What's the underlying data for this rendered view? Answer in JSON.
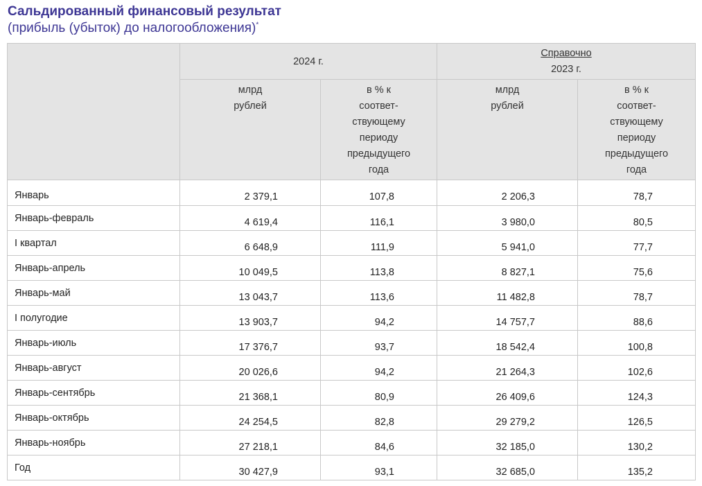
{
  "header": {
    "title": "Сальдированный финансовый результат",
    "subtitle": "(прибыль (убыток) до налогообложения)",
    "footnote_mark": "*"
  },
  "table": {
    "group_2024": "2024 г.",
    "group_ref_label": "Справочно",
    "group_ref_year": "2023 г.",
    "col_bln": "млрд\nрублей",
    "col_pct": "в % к\nсоответ-\nствующему\nпериоду\nпредыдущего\nгода",
    "rows": [
      {
        "label": "Январь",
        "v2024": "2 379,1",
        "p2024": "107,8",
        "v2023": "2 206,3",
        "p2023": "78,7"
      },
      {
        "label": "Январь-февраль",
        "v2024": "4 619,4",
        "p2024": "116,1",
        "v2023": "3 980,0",
        "p2023": "80,5"
      },
      {
        "label": "I квартал",
        "v2024": "6 648,9",
        "p2024": "111,9",
        "v2023": "5 941,0",
        "p2023": "77,7"
      },
      {
        "label": "Январь-апрель",
        "v2024": "10 049,5",
        "p2024": "113,8",
        "v2023": "8 827,1",
        "p2023": "75,6"
      },
      {
        "label": "Январь-май",
        "v2024": "13 043,7",
        "p2024": "113,6",
        "v2023": "11 482,8",
        "p2023": "78,7"
      },
      {
        "label": "I полугодие",
        "v2024": "13 903,7",
        "p2024": "94,2",
        "v2023": "14 757,7",
        "p2023": "88,6"
      },
      {
        "label": "Январь-июль",
        "v2024": "17 376,7",
        "p2024": "93,7",
        "v2023": "18 542,4",
        "p2023": "100,8"
      },
      {
        "label": "Январь-август",
        "v2024": "20 026,6",
        "p2024": "94,2",
        "v2023": "21 264,3",
        "p2023": "102,6"
      },
      {
        "label": "Январь-сентябрь",
        "v2024": "21 368,1",
        "p2024": "80,9",
        "v2023": "26 409,6",
        "p2023": "124,3"
      },
      {
        "label": "Январь-октябрь",
        "v2024": "24 254,5",
        "p2024": "82,8",
        "v2023": "29 279,2",
        "p2023": "126,5"
      },
      {
        "label": "Январь-ноябрь",
        "v2024": "27 218,1",
        "p2024": "84,6",
        "v2023": "32 185,0",
        "p2023": "130,2"
      },
      {
        "label": "Год",
        "v2024": "30 427,9",
        "p2024": "93,1",
        "v2023": "32 685,0",
        "p2023": "135,2"
      }
    ]
  }
}
